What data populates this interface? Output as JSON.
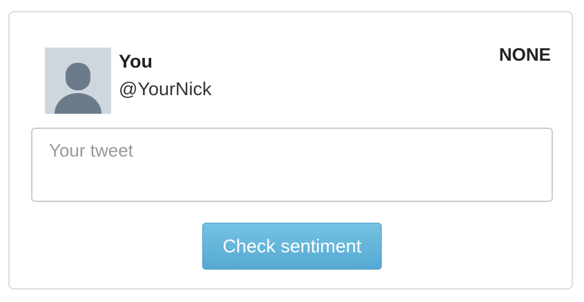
{
  "profile": {
    "name": "You",
    "handle": "@YourNick",
    "avatar_icon": "default-user-avatar-icon",
    "avatar_background": "#ced6de",
    "avatar_figure_color": "#6b7b89"
  },
  "sentiment": {
    "label": "NONE"
  },
  "tweet": {
    "value": "",
    "placeholder": "Your tweet"
  },
  "actions": {
    "check_label": "Check sentiment",
    "button_color": "#5bb0d8"
  }
}
